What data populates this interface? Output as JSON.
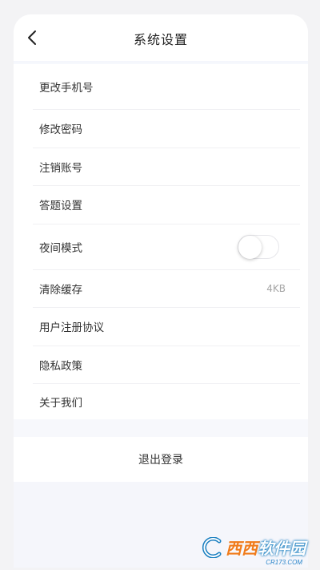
{
  "header": {
    "title": "系统设置",
    "back_icon": "chevron-left-icon"
  },
  "settings": [
    {
      "label": "更改手机号"
    },
    {
      "label": "修改密码"
    },
    {
      "label": "注销账号"
    },
    {
      "label": "答题设置"
    },
    {
      "label": "夜间模式",
      "toggle_on": false
    },
    {
      "label": "清除缓存",
      "value": "4KB"
    },
    {
      "label": "用户注册协议"
    },
    {
      "label": "隐私政策"
    },
    {
      "label": "关于我们"
    }
  ],
  "logout": {
    "label": "退出登录"
  },
  "watermark": {
    "text_main": "西西",
    "text_brand": "软件园",
    "text_sub": "CR173.COM"
  }
}
